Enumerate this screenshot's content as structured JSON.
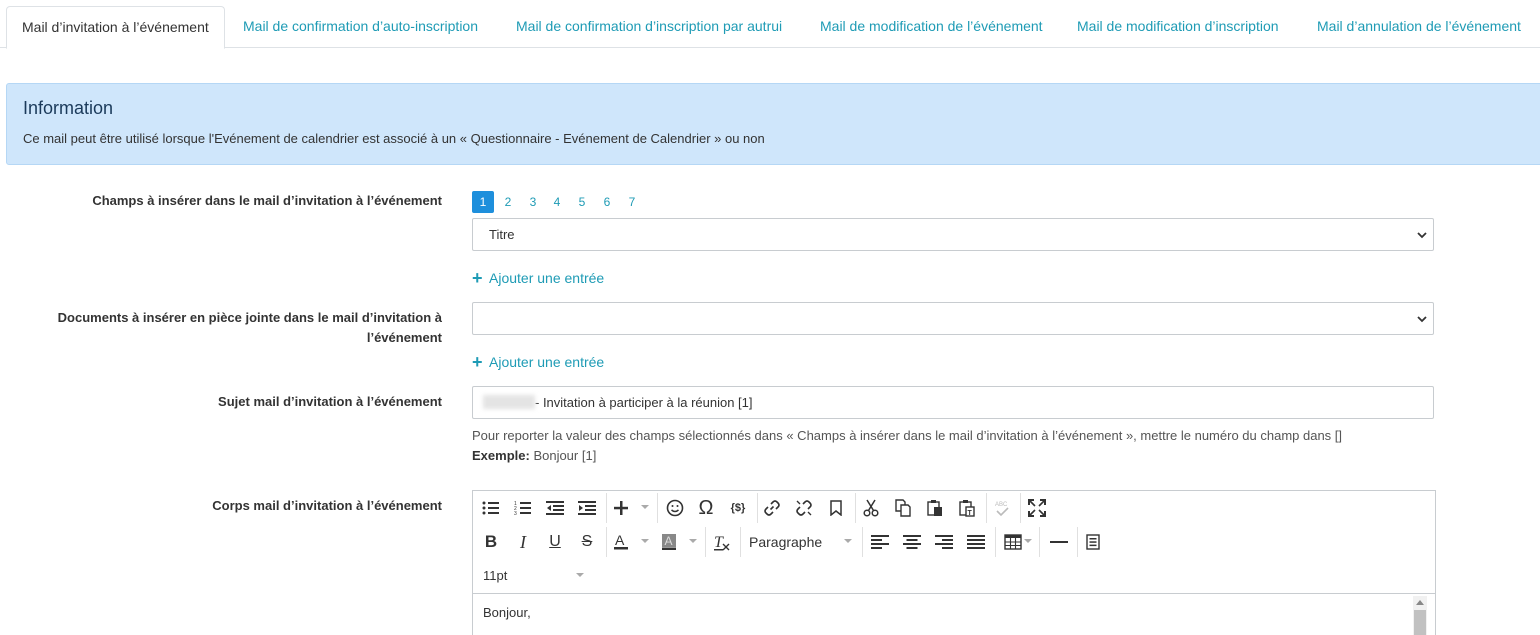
{
  "tabs": [
    {
      "label": "Mail d’invitation à l’événement",
      "active": true
    },
    {
      "label": "Mail de confirmation d’auto-inscription"
    },
    {
      "label": "Mail de confirmation d’inscription par autrui"
    },
    {
      "label": "Mail de modification de l’événement"
    },
    {
      "label": "Mail de modification d’inscription"
    },
    {
      "label": "Mail d’annulation de l’événement"
    }
  ],
  "info": {
    "title": "Information",
    "text": "Ce mail peut être utilisé lorsque l'Evénement de calendrier est associé à un « Questionnaire - Evénement de Calendrier » ou non"
  },
  "fields_section": {
    "label": "Champs à insérer dans le mail d’invitation à l’événement",
    "pages": [
      "1",
      "2",
      "3",
      "4",
      "5",
      "6",
      "7"
    ],
    "active_page": "1",
    "selected": "Titre",
    "add_label": "Ajouter une entrée"
  },
  "documents_section": {
    "label_line1": "Documents à insérer en pièce jointe dans le mail d’invitation à",
    "label_line2": "l’événement",
    "selected": "",
    "add_label": "Ajouter une entrée"
  },
  "subject_section": {
    "label": "Sujet mail d’invitation à l’événement",
    "value": "- Invitation à participer à la réunion [1]",
    "help": "Pour reporter la valeur des champs sélectionnés dans « Champs à insérer dans le mail d’invitation à l’événement », mettre le numéro du champ dans []",
    "example_label": "Exemple:",
    "example_value": "Bonjour [1]"
  },
  "body_section": {
    "label": "Corps mail d’invitation à l’événement",
    "format_select": "Paragraphe",
    "size_select": "11pt",
    "content": "Bonjour,"
  },
  "icons": {
    "row1": [
      "bullet-list-icon",
      "numbered-list-icon",
      "outdent-icon",
      "indent-icon",
      "insert-plus-icon",
      "emoji-icon",
      "special-char-icon",
      "variable-icon",
      "link-icon",
      "unlink-icon",
      "bookmark-icon",
      "cut-icon",
      "copy-icon",
      "paste-icon",
      "paste-text-icon",
      "spellcheck-icon",
      "fullscreen-icon"
    ],
    "row2": [
      "bold-icon",
      "italic-icon",
      "underline-icon",
      "strikethrough-icon",
      "text-color-icon",
      "highlight-color-icon",
      "clear-format-icon",
      "align-left-icon",
      "align-center-icon",
      "align-right-icon",
      "align-justify-icon",
      "table-icon",
      "horizontal-rule-icon",
      "source-code-icon"
    ]
  },
  "colors": {
    "accent": "#1e9bb5",
    "active_page": "#1e8fdc",
    "info_bg": "#cfe6fb"
  }
}
